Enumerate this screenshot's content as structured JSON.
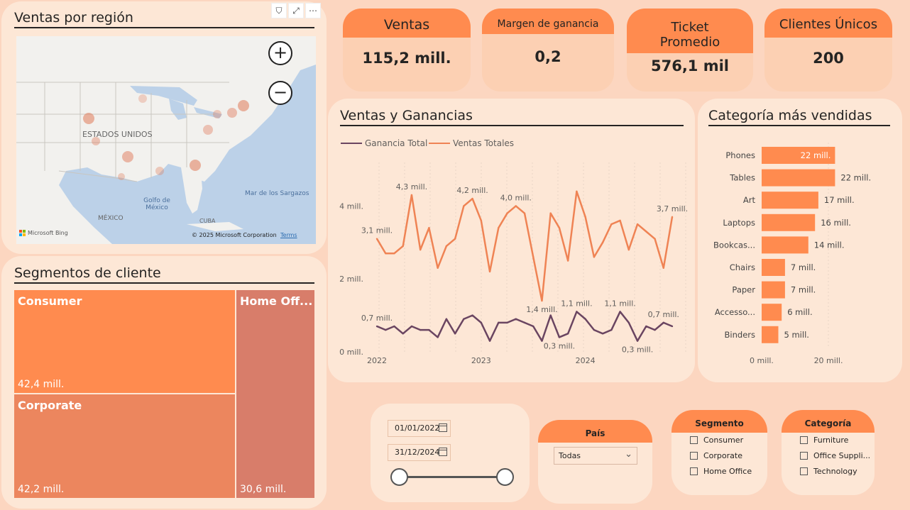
{
  "map_card": {
    "title": "Ventas por región",
    "country_label": "ESTADOS UNIDOS",
    "gulf_label": "Golfo de México",
    "sargasso_label": "Mar de los Sargazos",
    "mexico_label": "MÉXICO",
    "cuba_label": "CUBA",
    "copyright": "© 2025 Microsoft Corporation",
    "terms": "Terms",
    "bing": "Microsoft Bing"
  },
  "segments_card": {
    "title": "Segmentos de cliente",
    "items": [
      {
        "name": "Consumer",
        "value": "42,4 mill.",
        "color": "#ff8b4f"
      },
      {
        "name": "Corporate",
        "value": "42,2 mill.",
        "color": "#ec865e"
      },
      {
        "name": "Home Off...",
        "value": "30,6 mill.",
        "color": "#d87d6a"
      }
    ]
  },
  "kpis": {
    "ventas": {
      "label": "Ventas",
      "value": "115,2 mill."
    },
    "margen": {
      "label": "Margen de ganancia",
      "value": "0,2"
    },
    "ticket": {
      "label": "Ticket Promedio",
      "value": "576,1 mil"
    },
    "clientes": {
      "label": "Clientes Únicos",
      "value": "200"
    }
  },
  "line_card": {
    "title": "Ventas y Ganancias",
    "legend_profit": "Ganancia Total",
    "legend_sales": "Ventas Totales"
  },
  "bar_card": {
    "title": "Categoría más vendidas"
  },
  "date_slicer": {
    "start": "01/01/2022",
    "end": "31/12/2024"
  },
  "pais_slicer": {
    "title": "País",
    "selected": "Todas"
  },
  "segmento_slicer": {
    "title": "Segmento",
    "options": [
      "Consumer",
      "Corporate",
      "Home Office"
    ]
  },
  "categoria_slicer": {
    "title": "Categoría",
    "options": [
      "Furniture",
      "Office Suppli...",
      "Technology"
    ]
  },
  "colors": {
    "accent": "#ff8b4f",
    "sales_line": "#ef8354",
    "profit_line": "#6a4561",
    "card": "#fde7d6",
    "page": "#fcd6c0"
  },
  "chart_data": [
    {
      "type": "line",
      "title": "Ventas y Ganancias",
      "x_ticks": [
        "2022",
        "2023",
        "2024"
      ],
      "y_ticks": [
        "0 mill.",
        "2 mill.",
        "4 mill."
      ],
      "ylim": [
        0,
        5
      ],
      "series": [
        {
          "name": "Ventas Totales",
          "values": [
            3.1,
            2.7,
            2.7,
            2.9,
            4.3,
            2.8,
            3.4,
            2.3,
            2.9,
            3.1,
            4.0,
            4.2,
            3.6,
            2.2,
            3.4,
            3.8,
            4.0,
            3.8,
            2.6,
            1.4,
            3.8,
            3.4,
            2.5,
            4.4,
            3.7,
            2.6,
            3.0,
            3.5,
            3.6,
            2.8,
            3.5,
            3.3,
            3.1,
            2.3,
            3.7
          ],
          "labels": {
            "0": "3,1 mill.",
            "4": "4,3 mill.",
            "11": "4,2 mill.",
            "16": "4,0 mill.",
            "19": "1,4 mill.",
            "34": "3,7 mill."
          }
        },
        {
          "name": "Ganancia Total",
          "values": [
            0.7,
            0.6,
            0.7,
            0.5,
            0.7,
            0.6,
            0.6,
            0.4,
            0.9,
            0.5,
            0.9,
            1.0,
            0.8,
            0.3,
            0.8,
            0.8,
            0.9,
            0.8,
            0.7,
            0.3,
            1.0,
            0.4,
            0.5,
            1.1,
            0.9,
            0.6,
            0.5,
            0.6,
            1.1,
            0.8,
            0.3,
            0.7,
            0.6,
            0.8,
            0.7
          ],
          "labels": {
            "0": "0,7 mill.",
            "21": "0,3 mill.",
            "23": "1,1 mill.",
            "28": "1,1 mill.",
            "30": "0,3 mill.",
            "33": "0,7 mill."
          }
        }
      ]
    },
    {
      "type": "bar",
      "orientation": "horizontal",
      "title": "Categoría más vendidas",
      "categories": [
        "Phones",
        "Tables",
        "Art",
        "Laptops",
        "Bookcas...",
        "Chairs",
        "Paper",
        "Accesso...",
        "Binders"
      ],
      "values": [
        22,
        22,
        17,
        16,
        14,
        7,
        7,
        6,
        5
      ],
      "value_labels": [
        "22 mill.",
        "22 mill.",
        "17 mill.",
        "16 mill.",
        "14 mill.",
        "7 mill.",
        "7 mill.",
        "6 mill.",
        "5 mill."
      ],
      "x_ticks": [
        "0 mill.",
        "20 mill."
      ],
      "xlim": [
        0,
        20
      ]
    },
    {
      "type": "heatmap",
      "title": "Ventas por región"
    }
  ]
}
